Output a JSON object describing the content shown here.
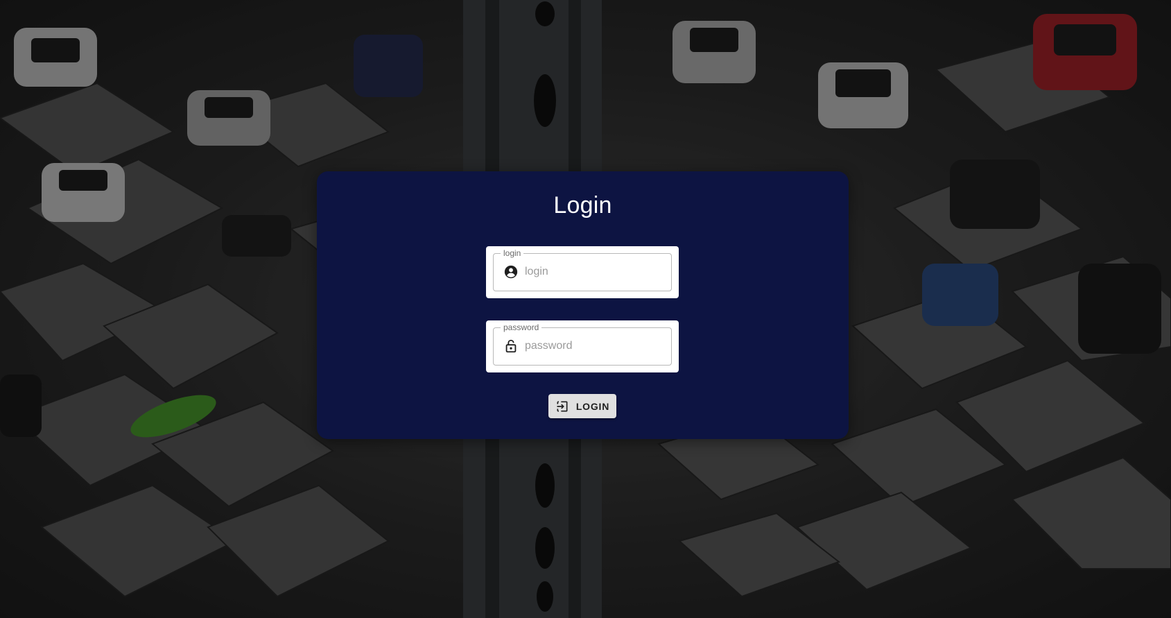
{
  "page": {
    "title": "Login",
    "background_image": "parking-garage-tower-photo"
  },
  "form": {
    "login": {
      "legend": "login",
      "placeholder": "login",
      "value": "",
      "icon": "account-circle-icon"
    },
    "password": {
      "legend": "password",
      "placeholder": "password",
      "value": "",
      "icon": "lock-open-icon"
    },
    "submit": {
      "label": "LOGIN",
      "icon": "login-icon"
    }
  },
  "colors": {
    "card": "#0d1442",
    "field_background": "#ffffff",
    "button_background": "#e0e0e0",
    "title_text": "#ffffff"
  }
}
